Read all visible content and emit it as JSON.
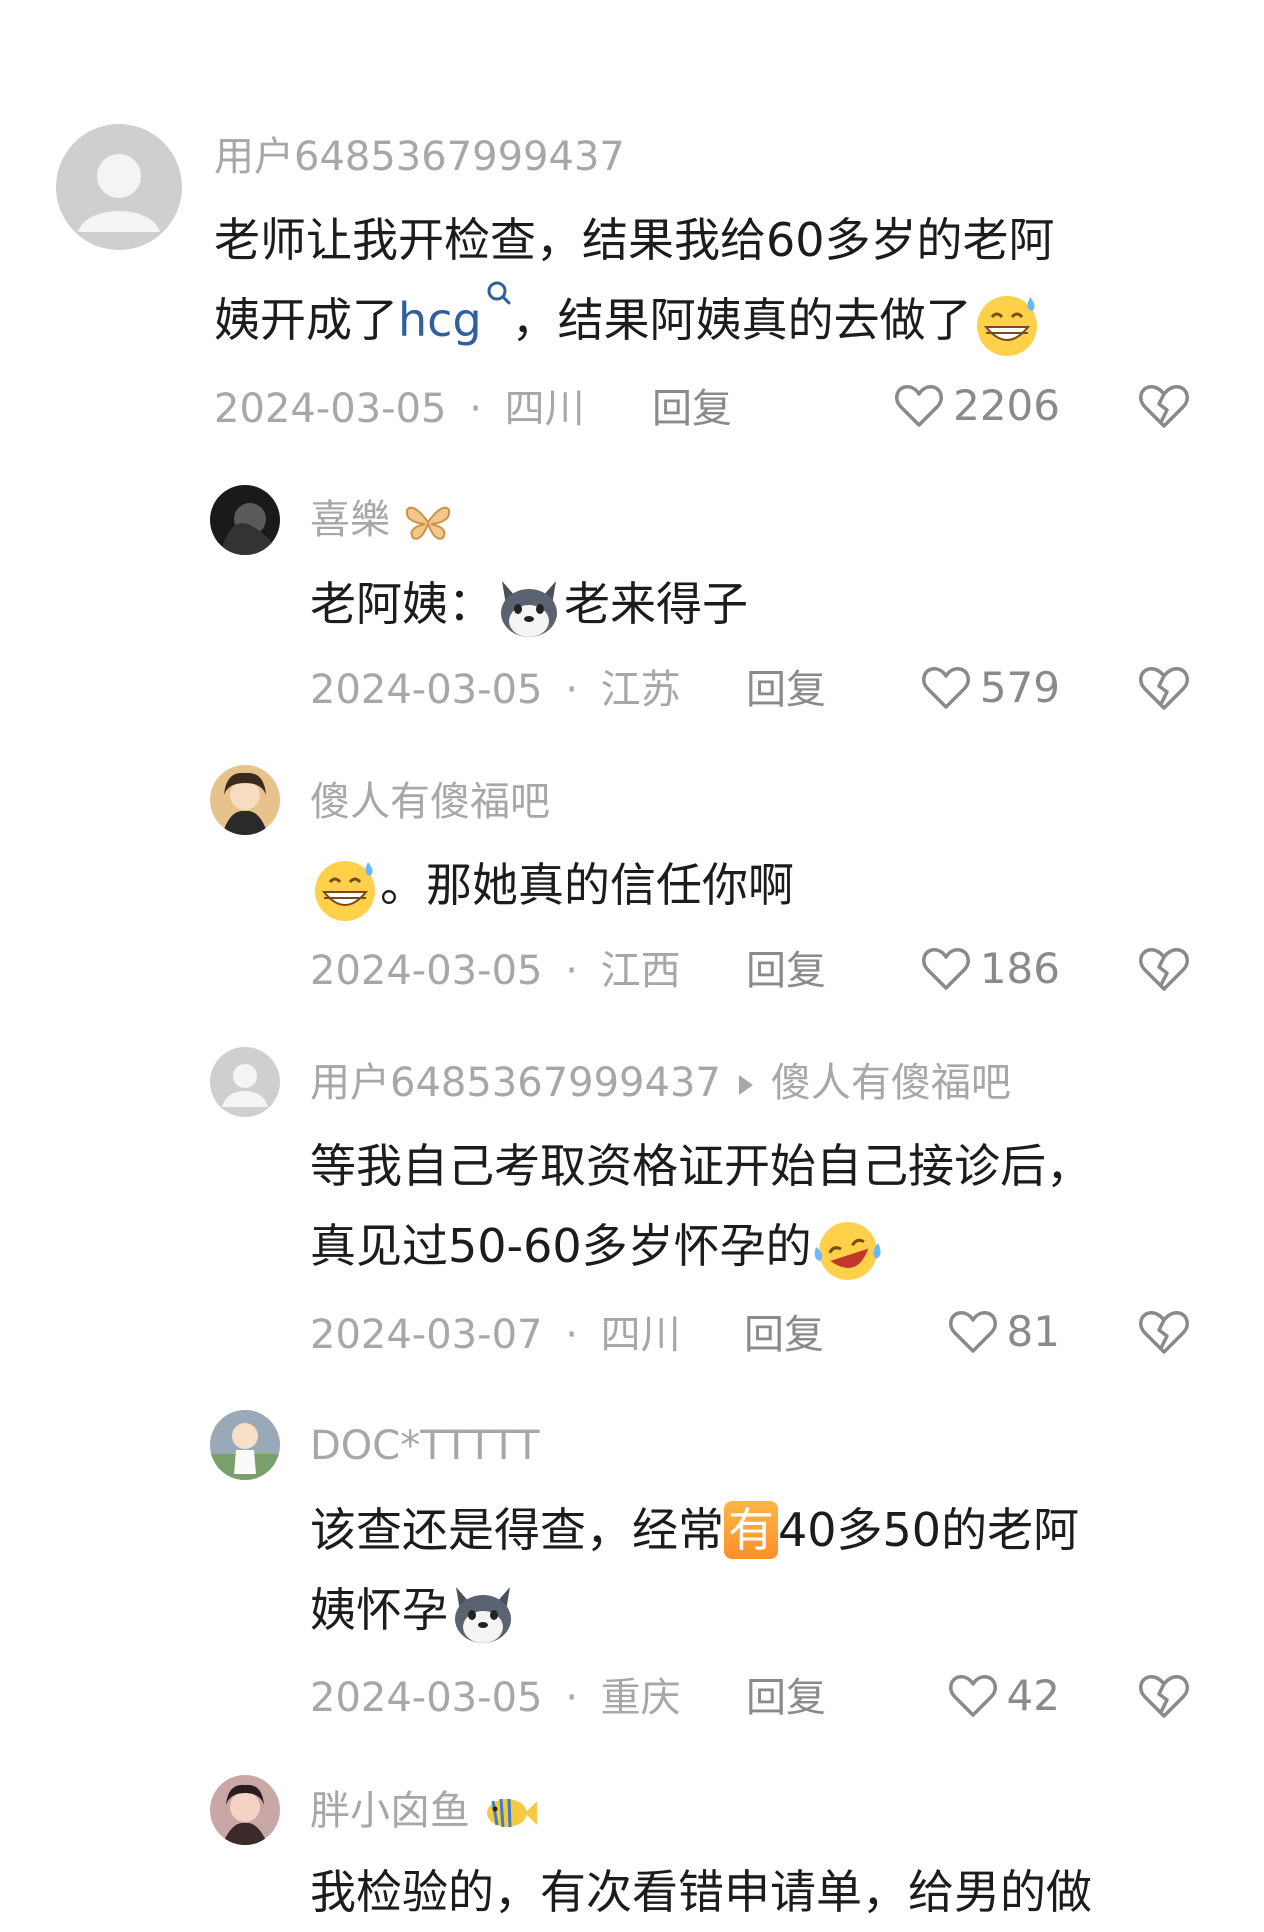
{
  "comments": [
    {
      "username": "用户6485367999437",
      "text_line1": "老师让我开检查，结果我给60多岁的老阿",
      "text_line2_prefix": "姨开成了",
      "text_line2_link": "hcg",
      "text_line2_suffix": "，结果阿姨真的去做了",
      "emoji_end": "grin-sweat-emoji",
      "date": "2024-03-05",
      "location": "四川",
      "reply_label": "回复",
      "likes": "2206"
    },
    {
      "username": "喜樂",
      "name_emoji": "butterfly-emoji",
      "text_prefix": "老阿姨：",
      "text_emoji": "husky-dog-emoji",
      "text_suffix": "老来得子",
      "date": "2024-03-05",
      "location": "江苏",
      "reply_label": "回复",
      "likes": "579"
    },
    {
      "username": "傻人有傻福吧",
      "text_emoji": "grin-sweat-emoji",
      "text_suffix": "。那她真的信任你啊",
      "date": "2024-03-05",
      "location": "江西",
      "reply_label": "回复",
      "likes": "186"
    },
    {
      "username": "用户6485367999437",
      "reply_to": "傻人有傻福吧",
      "text_line1": "等我自己考取资格证开始自己接诊后，",
      "text_line2": "真见过50-60多岁怀孕的",
      "emoji_end": "laugh-cry-emoji",
      "date": "2024-03-07",
      "location": "四川",
      "reply_label": "回复",
      "likes": "81"
    },
    {
      "username": "DOC*TTTTT",
      "text_line1_prefix": "该查还是得查，经常",
      "text_line1_highlight": "有",
      "text_line1_suffix": "40多50的老阿",
      "text_line2": "姨怀孕",
      "emoji_end": "husky-dog-emoji",
      "date": "2024-03-05",
      "location": "重庆",
      "reply_label": "回复",
      "likes": "42"
    },
    {
      "username": "胖小囟鱼",
      "name_emoji": "fish-emoji",
      "text_line1": "我检验的，有次看错申请单，给男的做"
    }
  ],
  "separator": "·",
  "colors": {
    "name": "#a7a7a7",
    "text": "#1c1c1c",
    "link": "#2f5f9e",
    "meta": "#a7a7a7"
  }
}
